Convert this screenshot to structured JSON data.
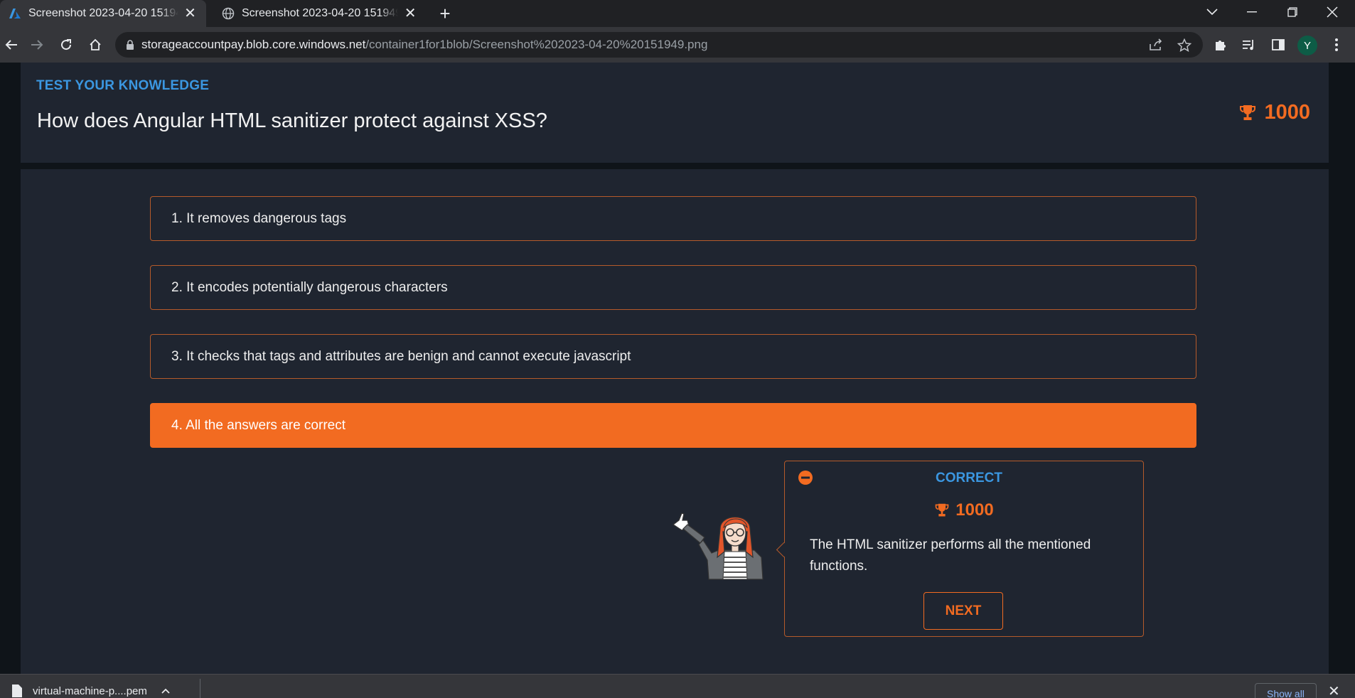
{
  "browser": {
    "tabs": [
      {
        "title": "Screenshot 2023-04-20 151949.png",
        "favicon": "azure-icon",
        "active": true
      },
      {
        "title": "Screenshot 2023-04-20 151949.png",
        "favicon": "globe-icon",
        "active": false
      }
    ],
    "url_host": "storageaccountpay.blob.core.windows.net",
    "url_path": "/container1for1blob/Screenshot%202023-04-20%20151949.png",
    "profile_initial": "Y"
  },
  "quiz": {
    "kicker": "TEST YOUR KNOWLEDGE",
    "question": "How does Angular HTML sanitizer protect against XSS?",
    "score": "1000",
    "answers": [
      {
        "label": "1. It removes dangerous tags"
      },
      {
        "label": "2. It encodes potentially dangerous characters"
      },
      {
        "label": "3. It checks that tags and attributes are benign and cannot execute javascript"
      },
      {
        "label": "4. All the answers are correct",
        "selected": true
      }
    ],
    "feedback": {
      "status": "CORRECT",
      "score": "1000",
      "explanation": "The HTML sanitizer performs all the mentioned functions.",
      "next_label": "NEXT"
    }
  },
  "downloads": {
    "file_name": "virtual-machine-p....pem",
    "show_all_label": "Show all"
  },
  "colors": {
    "accent_orange": "#f26b21",
    "accent_blue": "#3b97e1",
    "panel_bg": "#1f2530"
  }
}
